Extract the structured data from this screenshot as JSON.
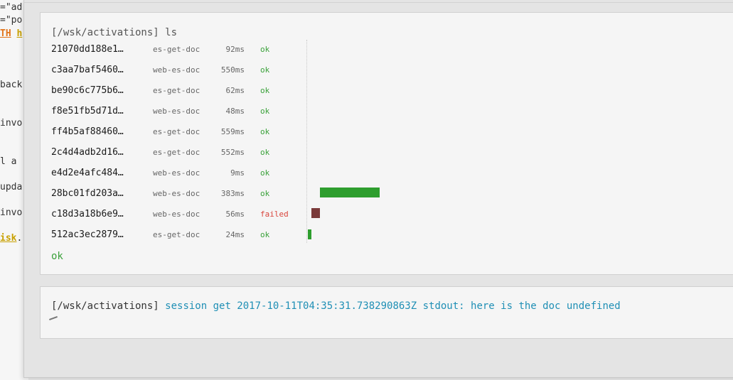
{
  "background_editor": {
    "lines": [
      "=\"ad",
      "=\"po",
      "TH",
      "h",
      "back",
      "invo",
      "l a",
      "upda",
      "invo",
      "isk",
      "."
    ]
  },
  "activations_block": {
    "prompt_path": "[/wsk/activations]",
    "command": "ls",
    "rows": [
      {
        "id": "21070dd188e1…",
        "name": "es-get-doc",
        "duration": "92ms",
        "status": "ok"
      },
      {
        "id": "c3aa7baf5460…",
        "name": "web-es-doc",
        "duration": "550ms",
        "status": "ok"
      },
      {
        "id": "be90c6c775b6…",
        "name": "es-get-doc",
        "duration": "62ms",
        "status": "ok"
      },
      {
        "id": "f8e51fb5d71d…",
        "name": "web-es-doc",
        "duration": "48ms",
        "status": "ok"
      },
      {
        "id": "ff4b5af88460…",
        "name": "es-get-doc",
        "duration": "559ms",
        "status": "ok"
      },
      {
        "id": "2c4d4adb2d16…",
        "name": "es-get-doc",
        "duration": "552ms",
        "status": "ok"
      },
      {
        "id": "e4d2e4afc484…",
        "name": "web-es-doc",
        "duration": "9ms",
        "status": "ok"
      },
      {
        "id": "28bc01fd203a…",
        "name": "web-es-doc",
        "duration": "383ms",
        "status": "ok"
      },
      {
        "id": "c18d3a18b6e9…",
        "name": "web-es-doc",
        "duration": "56ms",
        "status": "failed"
      },
      {
        "id": "512ac3ec2879…",
        "name": "es-get-doc",
        "duration": "24ms",
        "status": "ok"
      }
    ],
    "result": "ok"
  },
  "session_block": {
    "prompt_path": "[/wsk/activations]",
    "command": "session get 2017-10-11T04:35:31.738290863Z stdout: here is the doc undefined"
  },
  "colors": {
    "ok": "#3aa13a",
    "failed": "#d9463d",
    "bar_ok": "#2e9e2e",
    "bar_failed": "#7a3a3a",
    "session_command": "#1f8fb5"
  }
}
